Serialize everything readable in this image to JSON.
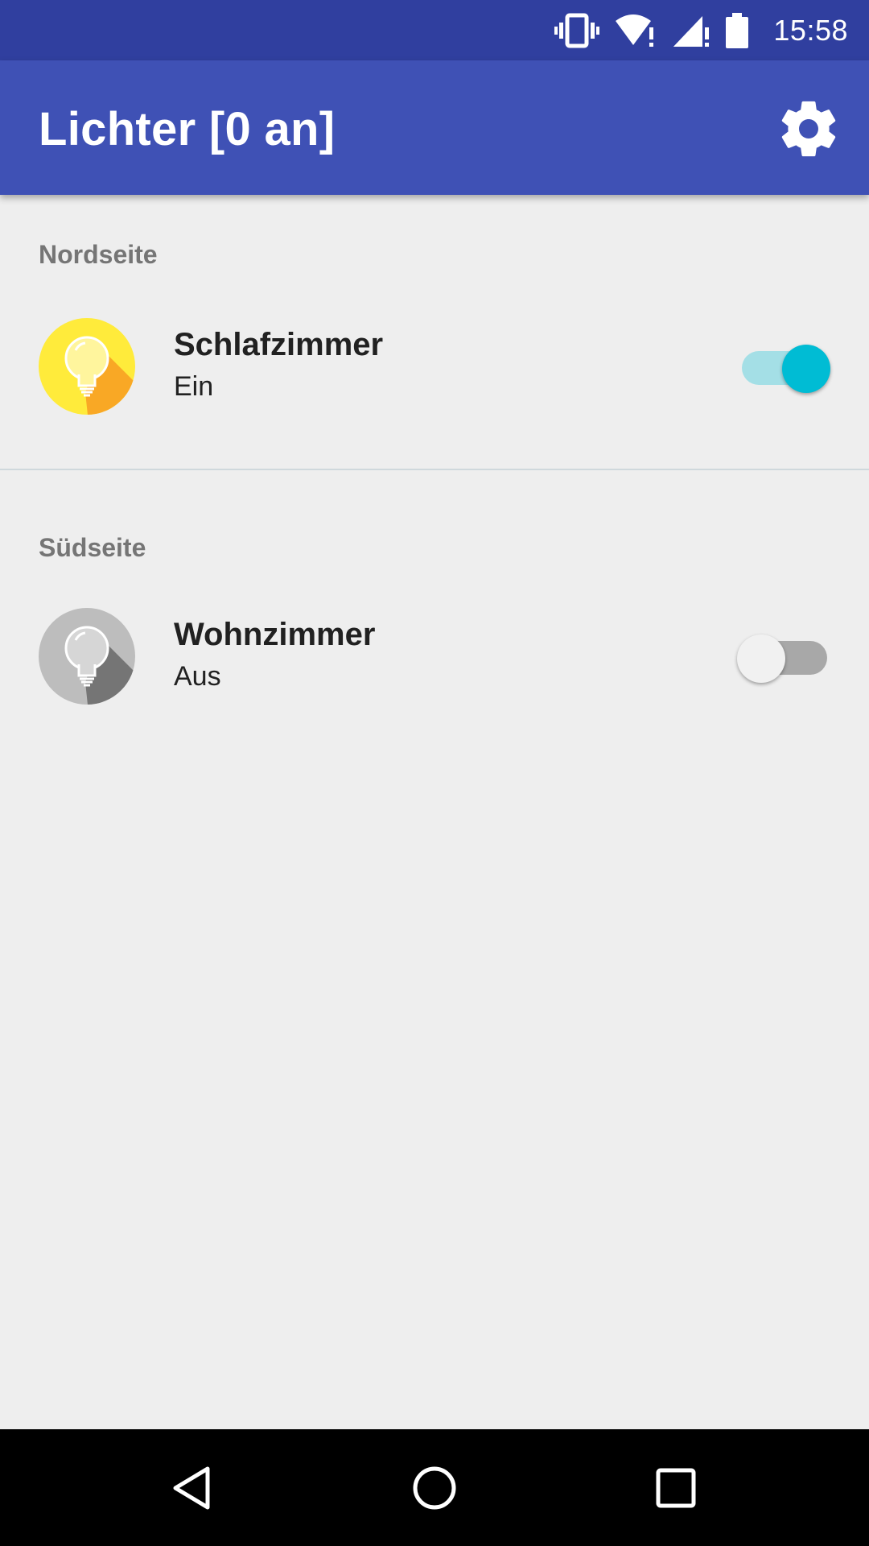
{
  "status_bar": {
    "time": "15:58",
    "icons": [
      "vibrate-icon",
      "wifi-alert-icon",
      "signal-alert-icon",
      "battery-icon"
    ]
  },
  "app_bar": {
    "title": "Lichter [0 an]",
    "settings_icon": "gear-icon"
  },
  "sections": [
    {
      "header": "Nordseite",
      "rooms": [
        {
          "name": "Schlafzimmer",
          "status": "Ein",
          "on": true,
          "icon": "lightbulb-on-icon"
        }
      ]
    },
    {
      "header": "Südseite",
      "rooms": [
        {
          "name": "Wohnzimmer",
          "status": "Aus",
          "on": false,
          "icon": "lightbulb-off-icon"
        }
      ]
    }
  ],
  "colors": {
    "status_bar": "#303f9f",
    "app_bar": "#3f51b5",
    "switch_on": "#00bcd4",
    "bulb_on": "#ffeb3b",
    "bulb_off": "#bdbdbd"
  },
  "nav_bar": {
    "icons": [
      "back-icon",
      "home-icon",
      "recent-apps-icon"
    ]
  }
}
